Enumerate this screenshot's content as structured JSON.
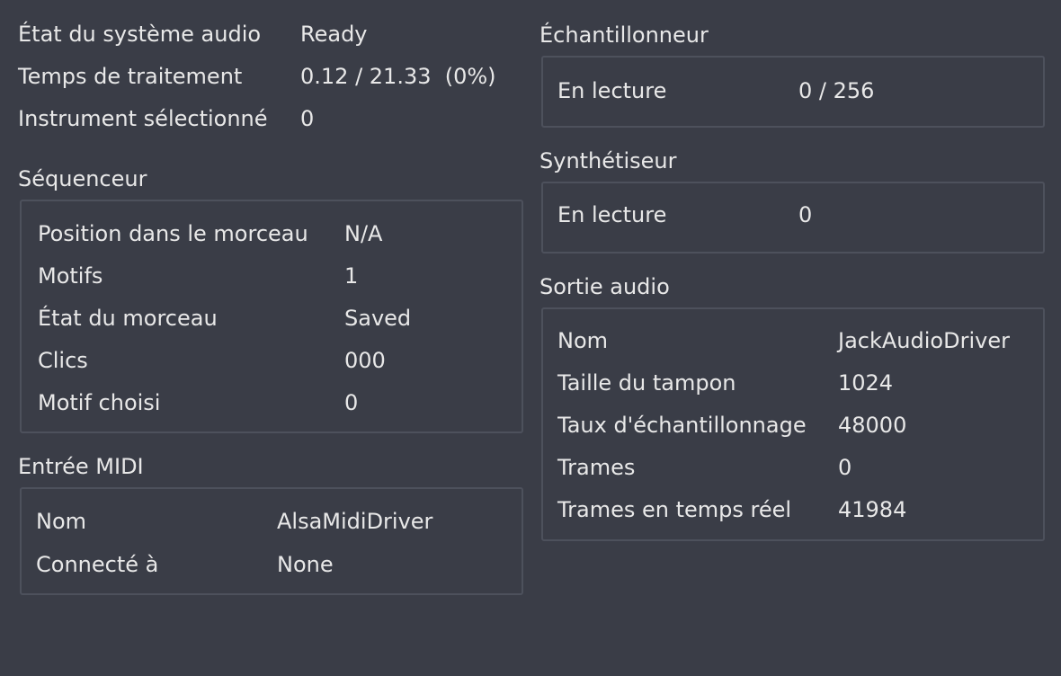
{
  "summary": {
    "audio_state_label": "État du système audio",
    "audio_state_value": "Ready",
    "processing_time_label": "Temps de traitement",
    "processing_time_value": "0.12 / 21.33  (0%)",
    "selected_instrument_label": "Instrument sélectionné",
    "selected_instrument_value": "0"
  },
  "sequencer": {
    "title": "Séquenceur",
    "rows": [
      {
        "label": "Position dans le morceau",
        "value": "N/A"
      },
      {
        "label": "Motifs",
        "value": "1"
      },
      {
        "label": "État du morceau",
        "value": "Saved"
      },
      {
        "label": "Clics",
        "value": "000"
      },
      {
        "label": "Motif choisi",
        "value": "0"
      }
    ]
  },
  "midi_input": {
    "title": "Entrée MIDI",
    "rows": [
      {
        "label": "Nom",
        "value": "AlsaMidiDriver"
      },
      {
        "label": "Connecté à",
        "value": "None"
      }
    ]
  },
  "sampler": {
    "title": "Échantillonneur",
    "playing_label": "En lecture",
    "playing_value": "0 / 256"
  },
  "synthesizer": {
    "title": "Synthétiseur",
    "playing_label": "En lecture",
    "playing_value": "0"
  },
  "audio_output": {
    "title": "Sortie audio",
    "rows": [
      {
        "label": "Nom",
        "value": "JackAudioDriver"
      },
      {
        "label": "Taille du tampon",
        "value": "1024"
      },
      {
        "label": "Taux d'échantillonnage",
        "value": "48000"
      },
      {
        "label": "Trames",
        "value": "0"
      },
      {
        "label": "Trames en temps réel",
        "value": "41984"
      }
    ]
  }
}
